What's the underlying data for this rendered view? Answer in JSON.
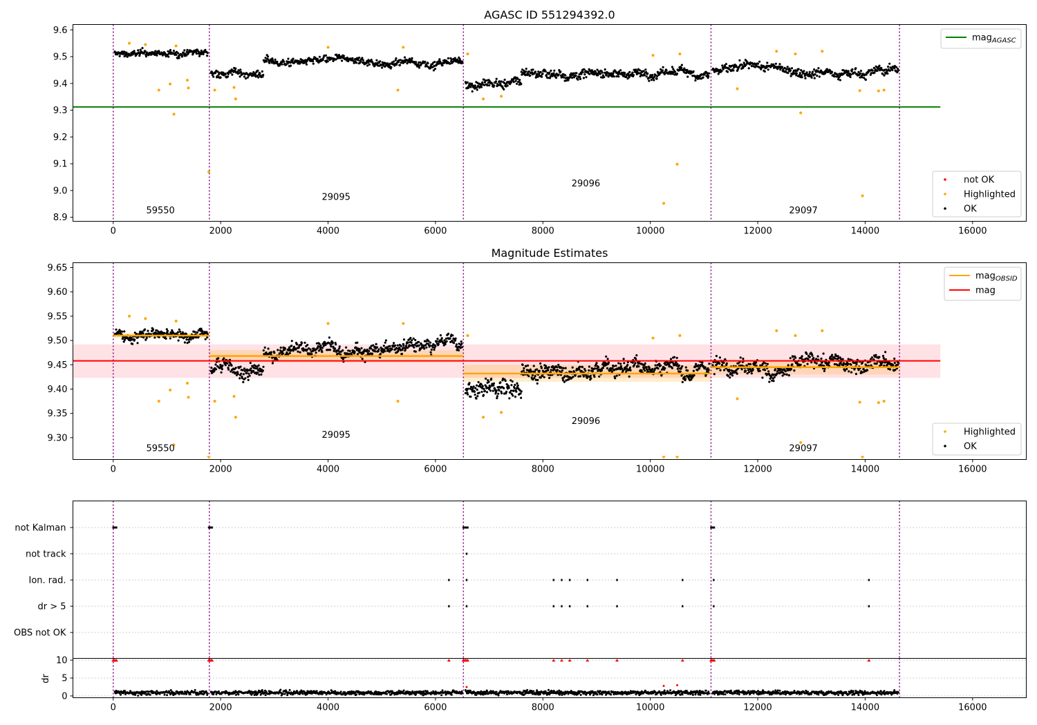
{
  "chart_data": [
    {
      "id": "top",
      "type": "scatter",
      "title": "AGASC ID 551294392.0",
      "xlim": [
        -750,
        17000
      ],
      "ylim": [
        8.885,
        9.62
      ],
      "xticks": [
        0,
        2000,
        4000,
        6000,
        8000,
        10000,
        12000,
        14000,
        16000
      ],
      "yticks": [
        8.9,
        9.0,
        9.1,
        9.2,
        9.3,
        9.4,
        9.5,
        9.6
      ],
      "ytick_labels": [
        "8.9",
        "9.0",
        "9.1",
        "9.2",
        "9.3",
        "9.4",
        "9.5",
        "9.6"
      ],
      "hlines": [
        {
          "name": "mag",
          "sub": "AGASC",
          "y": 9.312,
          "x": [
            -750,
            15400
          ],
          "color": "#008000"
        }
      ],
      "segments_boundaries": [
        0,
        1790,
        6520,
        11130,
        14640
      ],
      "obsid_labels": [
        {
          "text": "59550",
          "x": 880,
          "y": 8.915
        },
        {
          "text": "29095",
          "x": 4150,
          "y": 8.965
        },
        {
          "text": "29096",
          "x": 8800,
          "y": 9.015
        },
        {
          "text": "29097",
          "x": 12850,
          "y": 8.915
        }
      ],
      "ok_segments": [
        {
          "x": [
            30,
            1760
          ],
          "y_mean": 9.51,
          "y_noise": 0.025
        },
        {
          "x": [
            1820,
            2800
          ],
          "y_mean": 9.44,
          "y_noise": 0.035
        },
        {
          "x": [
            2800,
            6500
          ],
          "y_mean": 9.48,
          "y_noise": 0.03
        },
        {
          "x": [
            6560,
            7600
          ],
          "y_mean": 9.4,
          "y_noise": 0.04
        },
        {
          "x": [
            7600,
            11100
          ],
          "y_mean": 9.44,
          "y_noise": 0.035
        },
        {
          "x": [
            11160,
            14620
          ],
          "y_mean": 9.45,
          "y_noise": 0.035
        }
      ],
      "highlighted": [
        [
          850,
          9.375
        ],
        [
          1130,
          9.285
        ],
        [
          1380,
          9.412
        ],
        [
          1400,
          9.383
        ],
        [
          1060,
          9.398
        ],
        [
          1780,
          9.07
        ],
        [
          2280,
          9.342
        ],
        [
          2250,
          9.385
        ],
        [
          1890,
          9.375
        ],
        [
          5300,
          9.375
        ],
        [
          7225,
          9.352
        ],
        [
          10250,
          8.952
        ],
        [
          10500,
          9.098
        ],
        [
          12800,
          9.29
        ],
        [
          13950,
          8.98
        ],
        [
          14250,
          9.372
        ],
        [
          14350,
          9.375
        ],
        [
          6890,
          9.342
        ],
        [
          11620,
          9.38
        ],
        [
          13900,
          9.373
        ],
        [
          300,
          9.55
        ],
        [
          600,
          9.545
        ],
        [
          1170,
          9.54
        ],
        [
          4000,
          9.535
        ],
        [
          5400,
          9.535
        ],
        [
          6600,
          9.51
        ],
        [
          10050,
          9.505
        ],
        [
          10550,
          9.51
        ],
        [
          12350,
          9.52
        ],
        [
          12700,
          9.51
        ],
        [
          13200,
          9.52
        ]
      ],
      "legend": [
        {
          "label": "not OK",
          "color": "#ff0000",
          "kind": "dot"
        },
        {
          "label": "Highlighted",
          "color": "#ffa500",
          "kind": "dot"
        },
        {
          "label": "OK",
          "color": "#000000",
          "kind": "dot"
        }
      ],
      "legend_top": [
        {
          "label": "mag",
          "sub": "AGASC",
          "color": "#008000",
          "kind": "line"
        }
      ]
    },
    {
      "id": "mid",
      "type": "scatter",
      "title": "Magnitude Estimates",
      "xlim": [
        -750,
        17000
      ],
      "ylim": [
        9.255,
        9.66
      ],
      "xticks": [
        0,
        2000,
        4000,
        6000,
        8000,
        10000,
        12000,
        14000,
        16000
      ],
      "yticks": [
        9.3,
        9.35,
        9.4,
        9.45,
        9.5,
        9.55,
        9.6,
        9.65
      ],
      "ytick_labels": [
        "9.30",
        "9.35",
        "9.40",
        "9.45",
        "9.50",
        "9.55",
        "9.60",
        "9.65"
      ],
      "mag": {
        "y": 9.458,
        "band": [
          9.423,
          9.492
        ],
        "x": [
          -750,
          15400
        ],
        "color": "#ff0000"
      },
      "mag_obsid": [
        {
          "x": [
            0,
            1790
          ],
          "y": 9.51,
          "band": [
            9.505,
            9.515
          ]
        },
        {
          "x": [
            1790,
            6520
          ],
          "y": 9.468,
          "band": [
            9.455,
            9.48
          ]
        },
        {
          "x": [
            6520,
            11130
          ],
          "y": 9.432,
          "band": [
            9.415,
            9.45
          ]
        },
        {
          "x": [
            11130,
            14640
          ],
          "y": 9.445,
          "band": [
            9.43,
            9.46
          ]
        }
      ],
      "obsid_labels": [
        {
          "text": "59550",
          "x": 880,
          "y": 9.272
        },
        {
          "text": "29095",
          "x": 4150,
          "y": 9.3
        },
        {
          "text": "29096",
          "x": 8800,
          "y": 9.328
        },
        {
          "text": "29097",
          "x": 12850,
          "y": 9.272
        }
      ],
      "legend": [
        {
          "label": "Highlighted",
          "color": "#ffa500",
          "kind": "dot"
        },
        {
          "label": "OK",
          "color": "#000000",
          "kind": "dot"
        }
      ],
      "legend_top": [
        {
          "label": "mag",
          "sub": "OBSID",
          "color": "#ffa500",
          "kind": "line"
        },
        {
          "label": "mag",
          "sub": "",
          "color": "#ff0000",
          "kind": "line"
        }
      ]
    },
    {
      "id": "flags",
      "type": "scatter",
      "categories": [
        "not Kalman",
        "not track",
        "Ion. rad.",
        "dr > 5",
        "OBS not OK"
      ],
      "xlim": [
        -750,
        17000
      ],
      "points": {
        "not Kalman": [
          0,
          20,
          40,
          60,
          1780,
          1800,
          1820,
          1840,
          6520,
          6540,
          6560,
          6580,
          6600,
          11130,
          11150,
          11170,
          11190
        ],
        "not track": [
          6580
        ],
        "Ion. rad.": [
          6250,
          6580,
          8200,
          8350,
          8500,
          8830,
          9380,
          10600,
          11180,
          14070
        ],
        "dr > 5": [
          6250,
          6580,
          8200,
          8350,
          8500,
          8830,
          9380,
          10600,
          11180,
          14070
        ],
        "OBS not OK": []
      }
    },
    {
      "id": "dr",
      "type": "scatter",
      "ylabel": "dr",
      "xlim": [
        -750,
        17000
      ],
      "ylim": [
        -0.5,
        10.5
      ],
      "xticks": [
        0,
        2000,
        4000,
        6000,
        8000,
        10000,
        12000,
        14000,
        16000
      ],
      "yticks": [
        0,
        5,
        10
      ],
      "ytick_labels": [
        "0",
        "5",
        "10"
      ],
      "capped_red": [
        0,
        20,
        40,
        60,
        1780,
        1800,
        1820,
        1840,
        6250,
        6520,
        6540,
        6560,
        6580,
        6600,
        8200,
        8350,
        8500,
        8830,
        9380,
        10600,
        11130,
        11150,
        11170,
        11190,
        14070
      ],
      "red_low": [
        [
          10250,
          2.8
        ],
        [
          10500,
          3.0
        ],
        [
          6580,
          2.5
        ]
      ]
    }
  ],
  "xtick_labels": [
    "0",
    "2000",
    "4000",
    "6000",
    "8000",
    "10000",
    "12000",
    "14000",
    "16000"
  ]
}
